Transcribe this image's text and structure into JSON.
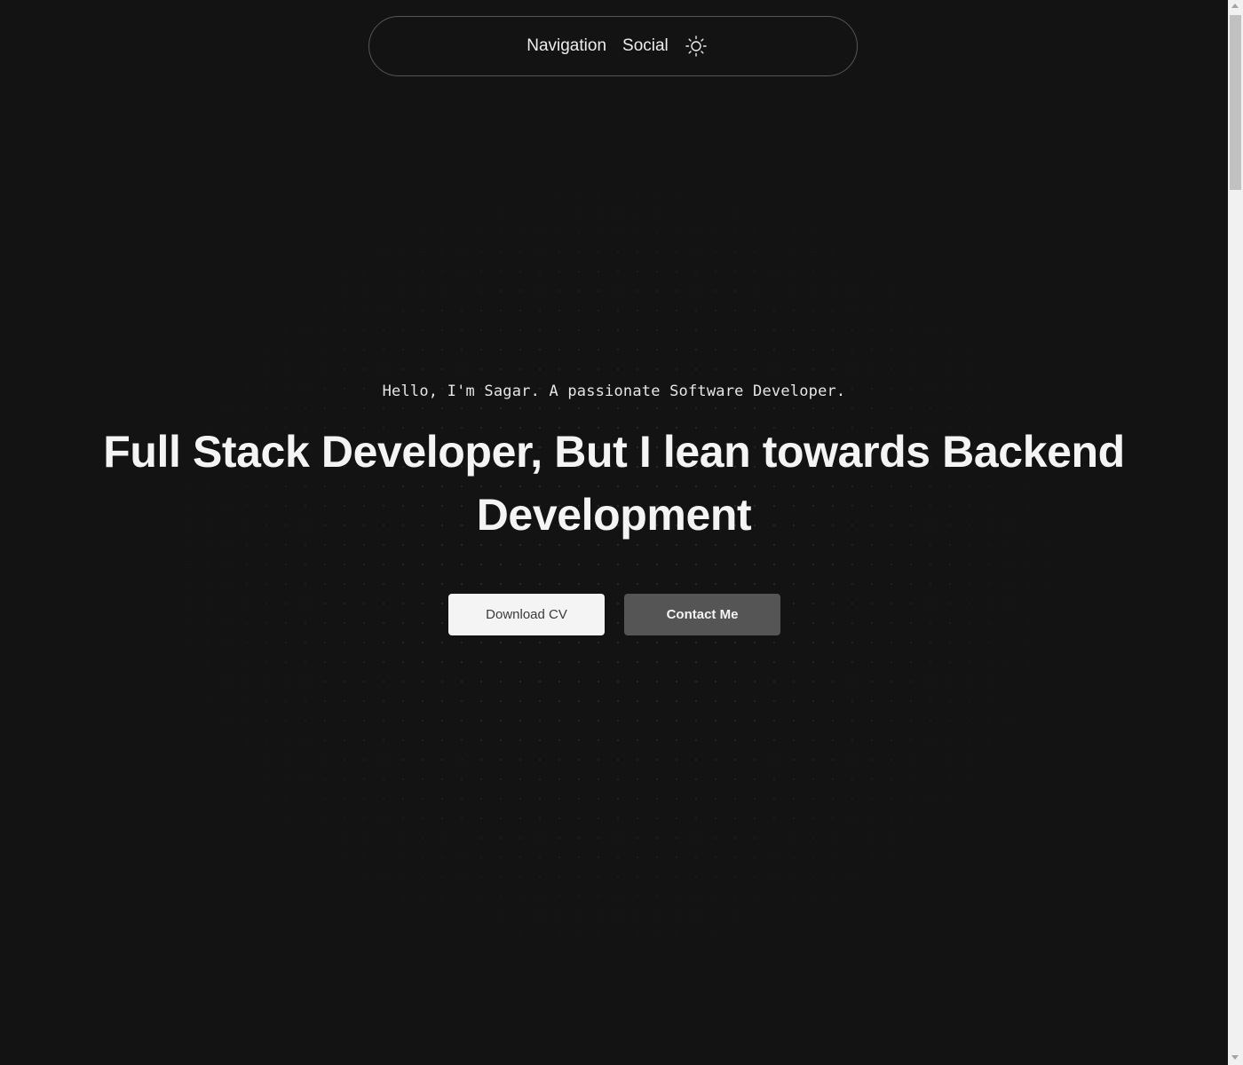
{
  "navbar": {
    "links": [
      "Navigation",
      "Social"
    ],
    "theme_toggle_icon": "sun-icon"
  },
  "hero": {
    "intro": "Hello, I'm Sagar. A passionate Software Developer.",
    "headline": "Full Stack Developer, But I lean towards Backend Development",
    "buttons": {
      "download_cv": "Download CV",
      "contact_me": "Contact Me"
    }
  },
  "colors": {
    "background": "#131313",
    "text": "#f4f4f4",
    "primary_button": "#f4f4f4",
    "secondary_button": "#555555",
    "nav_border": "#565656"
  }
}
